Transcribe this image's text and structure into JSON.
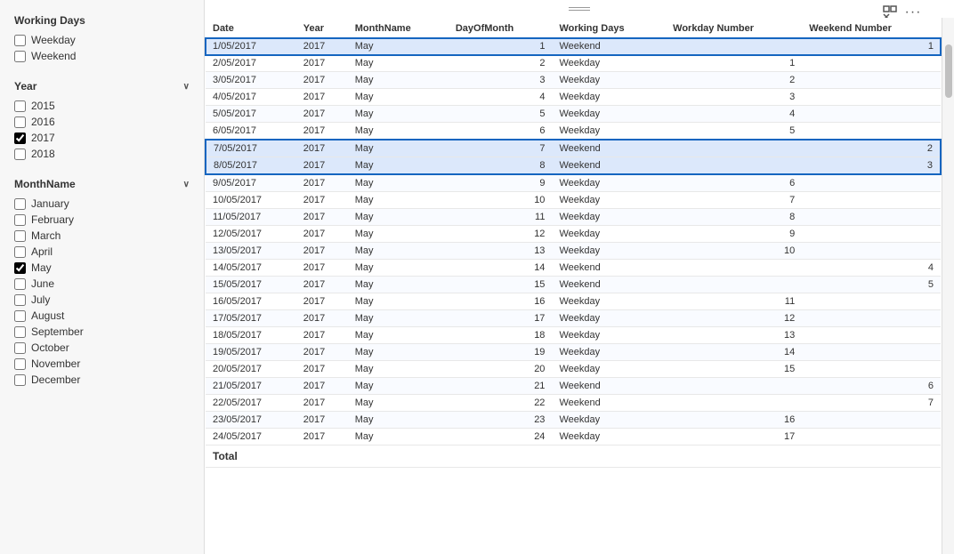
{
  "leftPanel": {
    "sections": [
      {
        "id": "working-days",
        "title": "Working Days",
        "collapsible": false,
        "items": [
          {
            "label": "Weekday",
            "checked": false
          },
          {
            "label": "Weekend",
            "checked": false
          }
        ]
      },
      {
        "id": "year",
        "title": "Year",
        "collapsible": true,
        "items": [
          {
            "label": "2015",
            "checked": false
          },
          {
            "label": "2016",
            "checked": false
          },
          {
            "label": "2017",
            "checked": true
          },
          {
            "label": "2018",
            "checked": false
          }
        ]
      },
      {
        "id": "month-name",
        "title": "MonthName",
        "collapsible": true,
        "items": [
          {
            "label": "January",
            "checked": false
          },
          {
            "label": "February",
            "checked": false
          },
          {
            "label": "March",
            "checked": false
          },
          {
            "label": "April",
            "checked": false
          },
          {
            "label": "May",
            "checked": true
          },
          {
            "label": "June",
            "checked": false
          },
          {
            "label": "July",
            "checked": false
          },
          {
            "label": "August",
            "checked": false
          },
          {
            "label": "September",
            "checked": false
          },
          {
            "label": "October",
            "checked": false
          },
          {
            "label": "November",
            "checked": false
          },
          {
            "label": "December",
            "checked": false
          }
        ]
      }
    ]
  },
  "table": {
    "columns": [
      "Date",
      "Year",
      "MonthName",
      "DayOfMonth",
      "Working Days",
      "Workday Number",
      "Weekend Number"
    ],
    "rows": [
      {
        "date": "1/05/2017",
        "year": "2017",
        "month": "May",
        "day": "1",
        "workingDays": "Weekend",
        "workdayNum": "",
        "weekendNum": "1",
        "highlight": "single"
      },
      {
        "date": "2/05/2017",
        "year": "2017",
        "month": "May",
        "day": "2",
        "workingDays": "Weekday",
        "workdayNum": "1",
        "weekendNum": "",
        "highlight": "none"
      },
      {
        "date": "3/05/2017",
        "year": "2017",
        "month": "May",
        "day": "3",
        "workingDays": "Weekday",
        "workdayNum": "2",
        "weekendNum": "",
        "highlight": "none"
      },
      {
        "date": "4/05/2017",
        "year": "2017",
        "month": "May",
        "day": "4",
        "workingDays": "Weekday",
        "workdayNum": "3",
        "weekendNum": "",
        "highlight": "none"
      },
      {
        "date": "5/05/2017",
        "year": "2017",
        "month": "May",
        "day": "5",
        "workingDays": "Weekday",
        "workdayNum": "4",
        "weekendNum": "",
        "highlight": "none"
      },
      {
        "date": "6/05/2017",
        "year": "2017",
        "month": "May",
        "day": "6",
        "workingDays": "Weekday",
        "workdayNum": "5",
        "weekendNum": "",
        "highlight": "none"
      },
      {
        "date": "7/05/2017",
        "year": "2017",
        "month": "May",
        "day": "7",
        "workingDays": "Weekend",
        "workdayNum": "",
        "weekendNum": "2",
        "highlight": "group-top"
      },
      {
        "date": "8/05/2017",
        "year": "2017",
        "month": "May",
        "day": "8",
        "workingDays": "Weekend",
        "workdayNum": "",
        "weekendNum": "3",
        "highlight": "group-bottom"
      },
      {
        "date": "9/05/2017",
        "year": "2017",
        "month": "May",
        "day": "9",
        "workingDays": "Weekday",
        "workdayNum": "6",
        "weekendNum": "",
        "highlight": "none"
      },
      {
        "date": "10/05/2017",
        "year": "2017",
        "month": "May",
        "day": "10",
        "workingDays": "Weekday",
        "workdayNum": "7",
        "weekendNum": "",
        "highlight": "none"
      },
      {
        "date": "11/05/2017",
        "year": "2017",
        "month": "May",
        "day": "11",
        "workingDays": "Weekday",
        "workdayNum": "8",
        "weekendNum": "",
        "highlight": "none"
      },
      {
        "date": "12/05/2017",
        "year": "2017",
        "month": "May",
        "day": "12",
        "workingDays": "Weekday",
        "workdayNum": "9",
        "weekendNum": "",
        "highlight": "none"
      },
      {
        "date": "13/05/2017",
        "year": "2017",
        "month": "May",
        "day": "13",
        "workingDays": "Weekday",
        "workdayNum": "10",
        "weekendNum": "",
        "highlight": "none"
      },
      {
        "date": "14/05/2017",
        "year": "2017",
        "month": "May",
        "day": "14",
        "workingDays": "Weekend",
        "workdayNum": "",
        "weekendNum": "4",
        "highlight": "none"
      },
      {
        "date": "15/05/2017",
        "year": "2017",
        "month": "May",
        "day": "15",
        "workingDays": "Weekend",
        "workdayNum": "",
        "weekendNum": "5",
        "highlight": "none"
      },
      {
        "date": "16/05/2017",
        "year": "2017",
        "month": "May",
        "day": "16",
        "workingDays": "Weekday",
        "workdayNum": "11",
        "weekendNum": "",
        "highlight": "none"
      },
      {
        "date": "17/05/2017",
        "year": "2017",
        "month": "May",
        "day": "17",
        "workingDays": "Weekday",
        "workdayNum": "12",
        "weekendNum": "",
        "highlight": "none"
      },
      {
        "date": "18/05/2017",
        "year": "2017",
        "month": "May",
        "day": "18",
        "workingDays": "Weekday",
        "workdayNum": "13",
        "weekendNum": "",
        "highlight": "none"
      },
      {
        "date": "19/05/2017",
        "year": "2017",
        "month": "May",
        "day": "19",
        "workingDays": "Weekday",
        "workdayNum": "14",
        "weekendNum": "",
        "highlight": "none"
      },
      {
        "date": "20/05/2017",
        "year": "2017",
        "month": "May",
        "day": "20",
        "workingDays": "Weekday",
        "workdayNum": "15",
        "weekendNum": "",
        "highlight": "none"
      },
      {
        "date": "21/05/2017",
        "year": "2017",
        "month": "May",
        "day": "21",
        "workingDays": "Weekend",
        "workdayNum": "",
        "weekendNum": "6",
        "highlight": "none"
      },
      {
        "date": "22/05/2017",
        "year": "2017",
        "month": "May",
        "day": "22",
        "workingDays": "Weekend",
        "workdayNum": "",
        "weekendNum": "7",
        "highlight": "none"
      },
      {
        "date": "23/05/2017",
        "year": "2017",
        "month": "May",
        "day": "23",
        "workingDays": "Weekday",
        "workdayNum": "16",
        "weekendNum": "",
        "highlight": "none"
      },
      {
        "date": "24/05/2017",
        "year": "2017",
        "month": "May",
        "day": "24",
        "workingDays": "Weekday",
        "workdayNum": "17",
        "weekendNum": "",
        "highlight": "none"
      }
    ],
    "totalLabel": "Total"
  },
  "icons": {
    "dragHandle": "≡",
    "expand": "⊡",
    "more": "..."
  }
}
